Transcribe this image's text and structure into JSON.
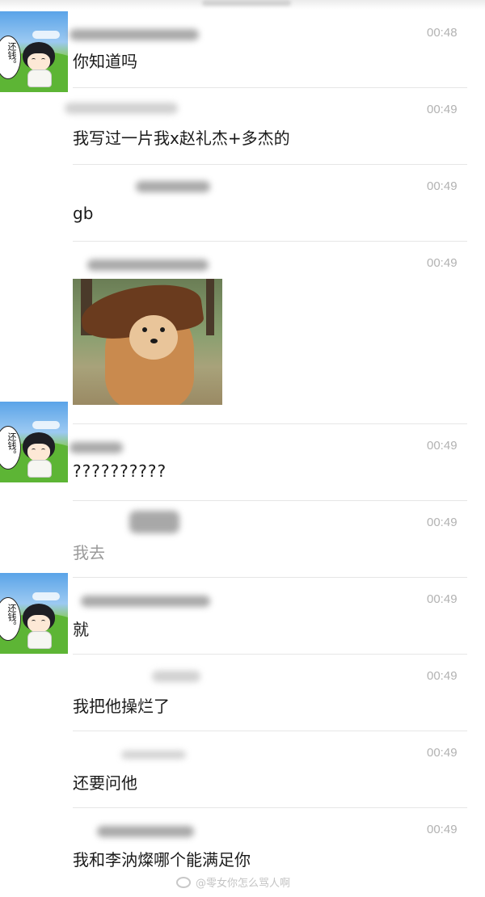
{
  "avatar": {
    "bubble_text": "还钱。"
  },
  "messages": [
    {
      "time": "00:48",
      "text": "你知道吗"
    },
    {
      "time": "00:49",
      "text": "我写过一片我x赵礼杰+多杰的"
    },
    {
      "time": "00:49",
      "text": "gb"
    },
    {
      "time": "00:49",
      "image": "dog-meme"
    },
    {
      "time": "00:49",
      "text": "??????????"
    },
    {
      "time": "00:49",
      "text": "我去"
    },
    {
      "time": "00:49",
      "text": "就"
    },
    {
      "time": "00:49",
      "text": "我把他操烂了"
    },
    {
      "time": "00:49",
      "text": "还要问他"
    },
    {
      "time": "00:49",
      "text": "我和李汭燦哪个能满足你"
    }
  ],
  "watermark": {
    "icon": "weibo-icon",
    "text": "@零女你怎么骂人啊"
  },
  "colors": {
    "timestamp": "#b2b2b2",
    "message_text": "#1a1a1a",
    "divider": "#e6e6e6"
  }
}
